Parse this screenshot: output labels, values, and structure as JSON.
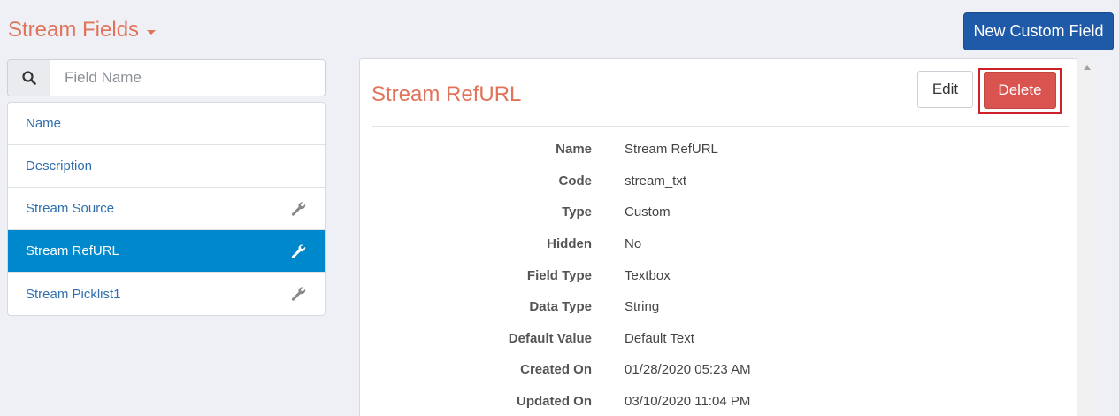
{
  "header": {
    "title": "Stream Fields",
    "new_button_label": "New Custom Field"
  },
  "search": {
    "placeholder": "Field Name",
    "value": ""
  },
  "field_list": {
    "items": [
      {
        "label": "Name",
        "has_wrench": false,
        "active": false
      },
      {
        "label": "Description",
        "has_wrench": false,
        "active": false
      },
      {
        "label": "Stream Source",
        "has_wrench": true,
        "active": false
      },
      {
        "label": "Stream RefURL",
        "has_wrench": true,
        "active": true
      },
      {
        "label": "Stream Picklist1",
        "has_wrench": true,
        "active": false
      }
    ]
  },
  "detail": {
    "title": "Stream RefURL",
    "edit_label": "Edit",
    "delete_label": "Delete",
    "properties": [
      {
        "label": "Name",
        "value": "Stream RefURL"
      },
      {
        "label": "Code",
        "value": "stream_txt"
      },
      {
        "label": "Type",
        "value": "Custom"
      },
      {
        "label": "Hidden",
        "value": "No"
      },
      {
        "label": "Field Type",
        "value": "Textbox"
      },
      {
        "label": "Data Type",
        "value": "String"
      },
      {
        "label": "Default Value",
        "value": "Default Text"
      },
      {
        "label": "Created On",
        "value": "01/28/2020 05:23 AM"
      },
      {
        "label": "Updated On",
        "value": "03/10/2020 11:04 PM"
      }
    ]
  },
  "colors": {
    "accent_title": "#e0735a",
    "primary_button": "#1f5aa8",
    "active_item": "#0088cc",
    "danger_button": "#d9534f",
    "highlight_outline": "#d0202a"
  },
  "icons": {
    "search": "search-icon",
    "wrench": "wrench-icon",
    "caret": "caret-down-icon"
  }
}
